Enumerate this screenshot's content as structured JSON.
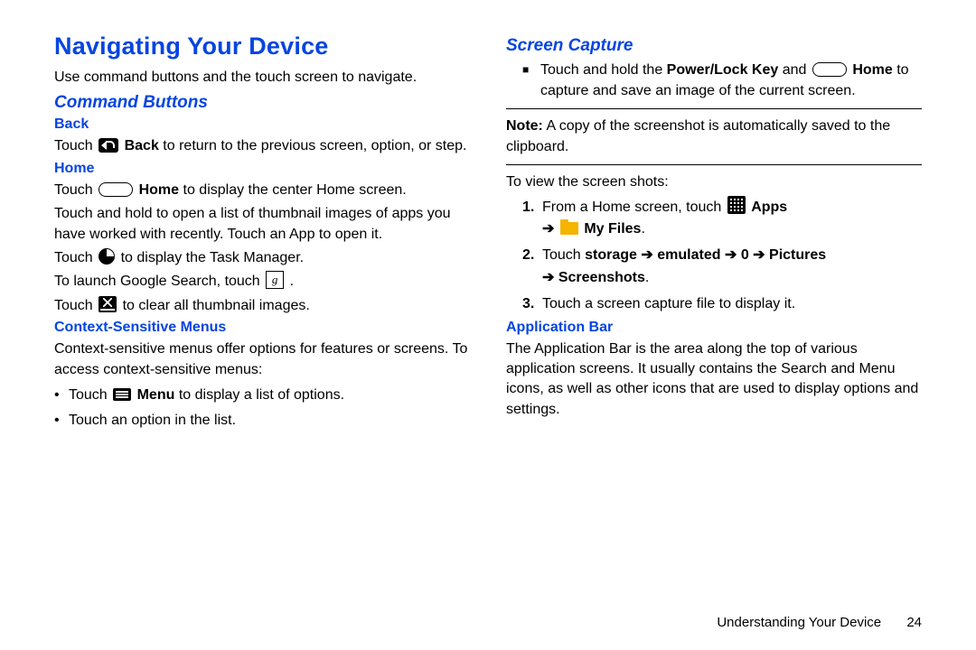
{
  "left": {
    "title": "Navigating Your Device",
    "intro": "Use command buttons and the touch screen to navigate.",
    "command_buttons_heading": "Command Buttons",
    "back": {
      "heading": "Back",
      "p1_a": "Touch ",
      "p1_b": " Back",
      "p1_c": " to return to the previous screen, option, or step."
    },
    "home": {
      "heading": "Home",
      "p1_a": "Touch ",
      "p1_b": " Home",
      "p1_c": " to display the center Home screen.",
      "p2": "Touch and hold to open a list of thumbnail images of apps you have worked with recently. Touch an App to open it.",
      "p3_a": "Touch ",
      "p3_b": " to display the Task Manager.",
      "p4_a": "To launch Google Search, touch ",
      "p4_b": " .",
      "p5_a": "Touch ",
      "p5_b": " to clear all thumbnail images."
    },
    "ctx": {
      "heading": "Context-Sensitive Menus",
      "p1": "Context-sensitive menus offer options for features or screens. To access context-sensitive menus:",
      "b1_a": "Touch ",
      "b1_menu": " Menu",
      "b1_b": " to display a list of options.",
      "b2": "Touch an option in the list."
    }
  },
  "right": {
    "screen_capture_heading": "Screen Capture",
    "sq1_a": "Touch and hold the ",
    "sq1_pl": "Power/Lock Key",
    "sq1_b": " and ",
    "sq1_home": " Home",
    "sq1_c": " to capture and save an image of the current screen.",
    "note_label": "Note:",
    "note_text": " A copy of the screenshot is automatically saved to the clipboard.",
    "view_intro": "To view the screen shots:",
    "s1_a": "From a Home screen, touch ",
    "s1_apps": " Apps",
    "s1_arrow": " ➔ ",
    "s1_myfiles": " My Files",
    "s1_end": ".",
    "s2_a": "Touch ",
    "s2_storage": "storage",
    "s2_arrow1": " ➔ ",
    "s2_emulated": "emulated",
    "s2_arrow2": " ➔ ",
    "s2_zero": "0",
    "s2_arrow3": " ➔ ",
    "s2_pictures": "Pictures",
    "s2_arrow4": " ➔ ",
    "s2_screenshots": "Screenshots",
    "s2_end": ".",
    "s3": "Touch a screen capture file to display it.",
    "appbar_heading": "Application Bar",
    "appbar_text": "The Application Bar is the area along the top of various application screens. It usually contains the Search and Menu icons, as well as other icons that are used to display options and settings."
  },
  "footer": {
    "section": "Understanding Your Device",
    "page": "24"
  }
}
